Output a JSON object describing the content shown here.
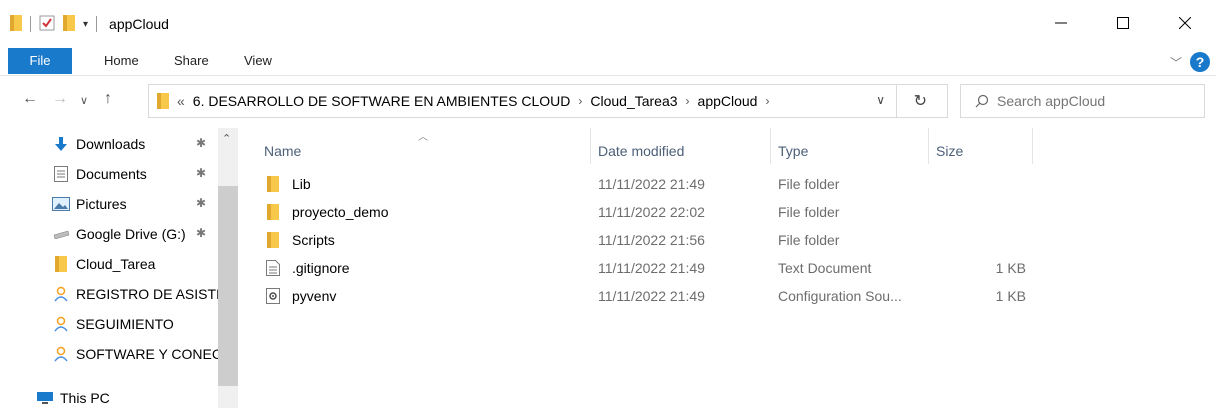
{
  "window": {
    "title": "appCloud"
  },
  "ribbon": {
    "tabs": [
      "File",
      "Home",
      "Share",
      "View"
    ]
  },
  "address": {
    "prefix": "«",
    "crumbs": [
      "6. DESARROLLO DE SOFTWARE EN AMBIENTES CLOUD",
      "Cloud_Tarea3",
      "appCloud"
    ]
  },
  "search": {
    "placeholder": "Search appCloud"
  },
  "sidebar": {
    "items": [
      {
        "label": "Downloads",
        "icon": "download-arrow-icon",
        "pinned": true
      },
      {
        "label": "Documents",
        "icon": "documents-icon",
        "pinned": true
      },
      {
        "label": "Pictures",
        "icon": "pictures-icon",
        "pinned": true
      },
      {
        "label": "Google Drive (G:)",
        "icon": "drive-icon",
        "pinned": true
      },
      {
        "label": "Cloud_Tarea",
        "icon": "folder-icon",
        "pinned": false
      },
      {
        "label": "REGISTRO DE ASISTI",
        "icon": "shared-folder-icon",
        "pinned": false
      },
      {
        "label": "SEGUIMIENTO",
        "icon": "shared-folder-icon",
        "pinned": false
      },
      {
        "label": "SOFTWARE Y CONEC",
        "icon": "shared-folder-icon",
        "pinned": false
      },
      {
        "label": "This PC",
        "icon": "this-pc-icon",
        "pinned": false
      }
    ]
  },
  "columns": {
    "name": "Name",
    "date": "Date modified",
    "type": "Type",
    "size": "Size"
  },
  "files": [
    {
      "name": "Lib",
      "date": "11/11/2022 21:49",
      "type": "File folder",
      "size": "",
      "icon": "folder-icon"
    },
    {
      "name": "proyecto_demo",
      "date": "11/11/2022 22:02",
      "type": "File folder",
      "size": "",
      "icon": "folder-icon"
    },
    {
      "name": "Scripts",
      "date": "11/11/2022 21:56",
      "type": "File folder",
      "size": "",
      "icon": "folder-icon"
    },
    {
      "name": ".gitignore",
      "date": "11/11/2022 21:49",
      "type": "Text Document",
      "size": "1 KB",
      "icon": "text-file-icon"
    },
    {
      "name": "pyvenv",
      "date": "11/11/2022 21:49",
      "type": "Configuration Sou...",
      "size": "1 KB",
      "icon": "config-file-icon"
    }
  ],
  "colors": {
    "accent": "#1979ca",
    "folder": "#f8c84a",
    "header_text": "#4c607a"
  }
}
